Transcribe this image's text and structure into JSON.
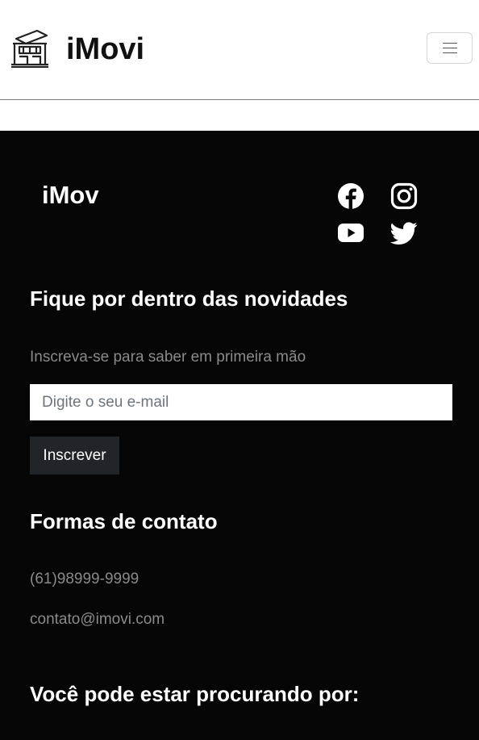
{
  "header": {
    "brand_name": "iMovi",
    "logo_icon": "building-icon",
    "menu_icon": "hamburger-menu-icon"
  },
  "footer": {
    "brand_name": "iMov",
    "social": [
      {
        "name": "facebook-icon"
      },
      {
        "name": "instagram-icon"
      },
      {
        "name": "youtube-icon"
      },
      {
        "name": "twitter-icon"
      }
    ],
    "newsletter": {
      "title": "Fique por dentro das novidades",
      "subtitle": "Inscreva-se para saber em primeira mão",
      "email_placeholder": "Digite o seu e-mail",
      "button_label": "Inscrever"
    },
    "contact": {
      "title": "Formas de contato",
      "phone": "(61)98999-9999",
      "email": "contato@imovi.com"
    },
    "search": {
      "title": "Você pode estar procurando por:"
    }
  },
  "colors": {
    "footer_bg": "#060606",
    "button_bg": "#212529",
    "muted_text": "#8a8a8a"
  }
}
